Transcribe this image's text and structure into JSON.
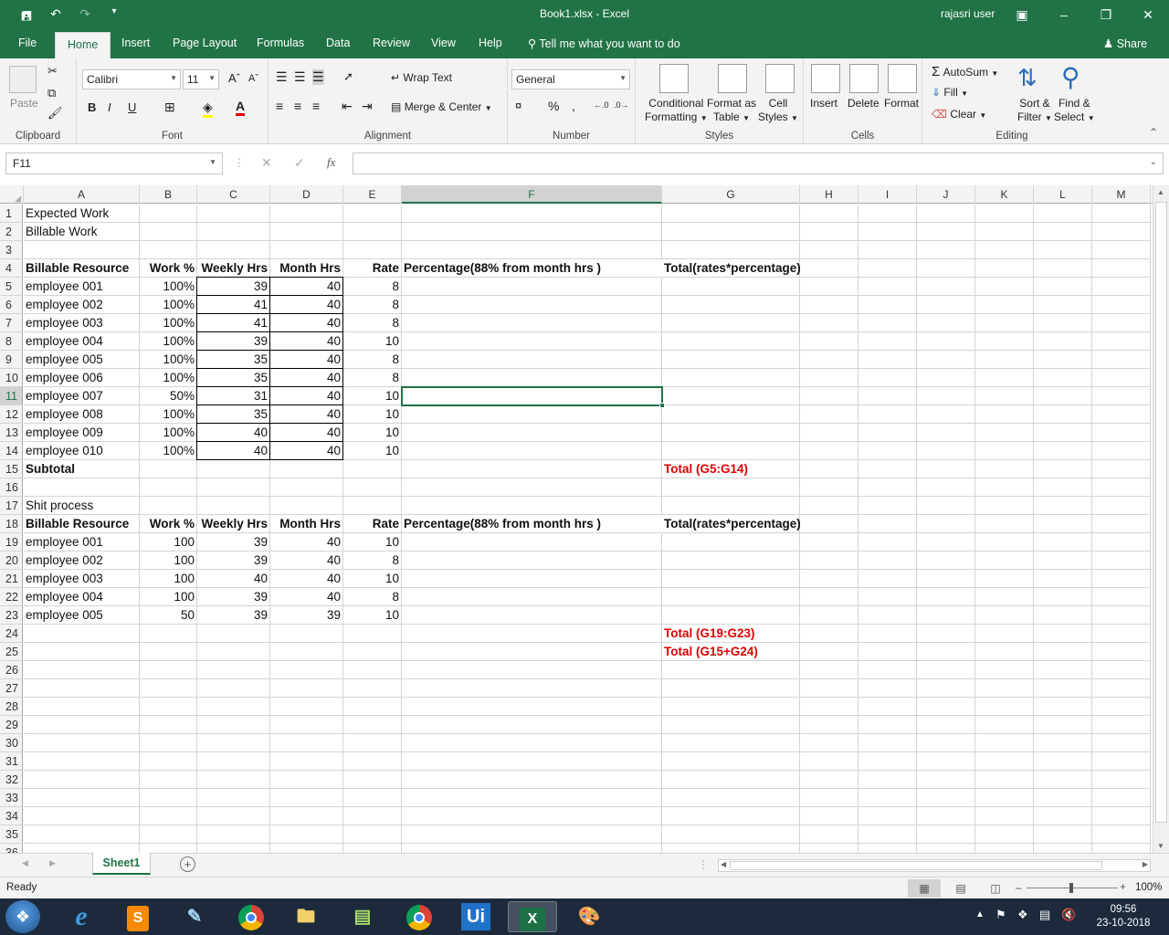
{
  "titlebar": {
    "document": "Book1.xlsx  -  Excel",
    "user": "rajasri user"
  },
  "tabs": [
    "File",
    "Home",
    "Insert",
    "Page Layout",
    "Formulas",
    "Data",
    "Review",
    "View",
    "Help"
  ],
  "tell_me": "Tell me what you want to do",
  "share": "Share",
  "ribbon": {
    "clipboard": {
      "label": "Clipboard",
      "paste": "Paste"
    },
    "font": {
      "label": "Font",
      "family": "Calibri",
      "size": "11",
      "bold": "B",
      "italic": "I",
      "underline": "U"
    },
    "alignment": {
      "label": "Alignment",
      "wrap": "Wrap Text",
      "merge": "Merge & Center"
    },
    "number": {
      "label": "Number",
      "format": "General"
    },
    "styles": {
      "label": "Styles",
      "conditional": "Conditional",
      "conditional2": "Formatting",
      "format_as": "Format as",
      "format_as2": "Table",
      "cell": "Cell",
      "cell2": "Styles"
    },
    "cells": {
      "label": "Cells",
      "insert": "Insert",
      "delete": "Delete",
      "format": "Format"
    },
    "editing": {
      "label": "Editing",
      "autosum": "AutoSum",
      "fill": "Fill",
      "clear": "Clear",
      "sort": "Sort &",
      "sort2": "Filter",
      "find": "Find &",
      "find2": "Select"
    }
  },
  "formula_bar": {
    "name_box": "F11",
    "formula": ""
  },
  "columns": [
    "A",
    "B",
    "C",
    "D",
    "E",
    "F",
    "G",
    "H",
    "I",
    "J",
    "K",
    "L",
    "M"
  ],
  "selected_cell": "F11",
  "rows": [
    {
      "n": 1,
      "A": "Expected Work"
    },
    {
      "n": 2,
      "A": "Billable Work"
    },
    {
      "n": 3
    },
    {
      "n": 4,
      "A": " Billable Resource",
      "B": "Work %",
      "C": "Weekly Hrs",
      "D": "Month Hrs",
      "E": "Rate",
      "F": "Percentage(88% from month hrs )",
      "G": "Total(rates*percentage)",
      "bold": true
    },
    {
      "n": 5,
      "A": "employee 001",
      "B": "100%",
      "C": "39",
      "D": "40",
      "E": "8"
    },
    {
      "n": 6,
      "A": "employee 002",
      "B": "100%",
      "C": "41",
      "D": "40",
      "E": "8"
    },
    {
      "n": 7,
      "A": "employee 003",
      "B": "100%",
      "C": "41",
      "D": "40",
      "E": "8"
    },
    {
      "n": 8,
      "A": "employee 004",
      "B": "100%",
      "C": "39",
      "D": "40",
      "E": "10"
    },
    {
      "n": 9,
      "A": "employee 005",
      "B": "100%",
      "C": "35",
      "D": "40",
      "E": "8"
    },
    {
      "n": 10,
      "A": "employee 006",
      "B": "100%",
      "C": "35",
      "D": "40",
      "E": "8"
    },
    {
      "n": 11,
      "A": "employee 007",
      "B": "50%",
      "C": "31",
      "D": "40",
      "E": "10"
    },
    {
      "n": 12,
      "A": "employee 008",
      "B": "100%",
      "C": "35",
      "D": "40",
      "E": "10"
    },
    {
      "n": 13,
      "A": "employee 009",
      "B": "100%",
      "C": "40",
      "D": "40",
      "E": "10"
    },
    {
      "n": 14,
      "A": "employee 010",
      "B": "100%",
      "C": "40",
      "D": "40",
      "E": "10"
    },
    {
      "n": 15,
      "A": "Subtotal",
      "G": "Total (G5:G14)",
      "Abold": true,
      "Gred": true
    },
    {
      "n": 16
    },
    {
      "n": 17,
      "A": "Shit process"
    },
    {
      "n": 18,
      "A": " Billable Resource",
      "B": "Work %",
      "C": "Weekly Hrs",
      "D": "Month Hrs",
      "E": "Rate",
      "F": "Percentage(88% from month hrs )",
      "G": "Total(rates*percentage)",
      "bold": true
    },
    {
      "n": 19,
      "A": "employee 001",
      "B": "100",
      "C": "39",
      "D": "40",
      "E": "10"
    },
    {
      "n": 20,
      "A": "employee 002",
      "B": "100",
      "C": "39",
      "D": "40",
      "E": "8"
    },
    {
      "n": 21,
      "A": "employee 003",
      "B": "100",
      "C": "40",
      "D": "40",
      "E": "10"
    },
    {
      "n": 22,
      "A": "employee 004",
      "B": "100",
      "C": "39",
      "D": "40",
      "E": "8"
    },
    {
      "n": 23,
      "A": "employee 005",
      "B": "50",
      "C": "39",
      "D": "39",
      "E": "10"
    },
    {
      "n": 24,
      "G": "Total (G19:G23)",
      "Gred": true
    },
    {
      "n": 25,
      "G": "Total (G15+G24)",
      "Gred": true
    },
    {
      "n": 26
    },
    {
      "n": 27
    },
    {
      "n": 28
    },
    {
      "n": 29
    },
    {
      "n": 30
    },
    {
      "n": 31
    },
    {
      "n": 32
    },
    {
      "n": 33
    },
    {
      "n": 34
    },
    {
      "n": 35
    },
    {
      "n": 36
    }
  ],
  "sheet_tab": "Sheet1",
  "status": {
    "ready": "Ready",
    "zoom": "100%"
  },
  "taskbar": {
    "time": "09:56",
    "date": "23-10-2018"
  },
  "accent": "#217346"
}
